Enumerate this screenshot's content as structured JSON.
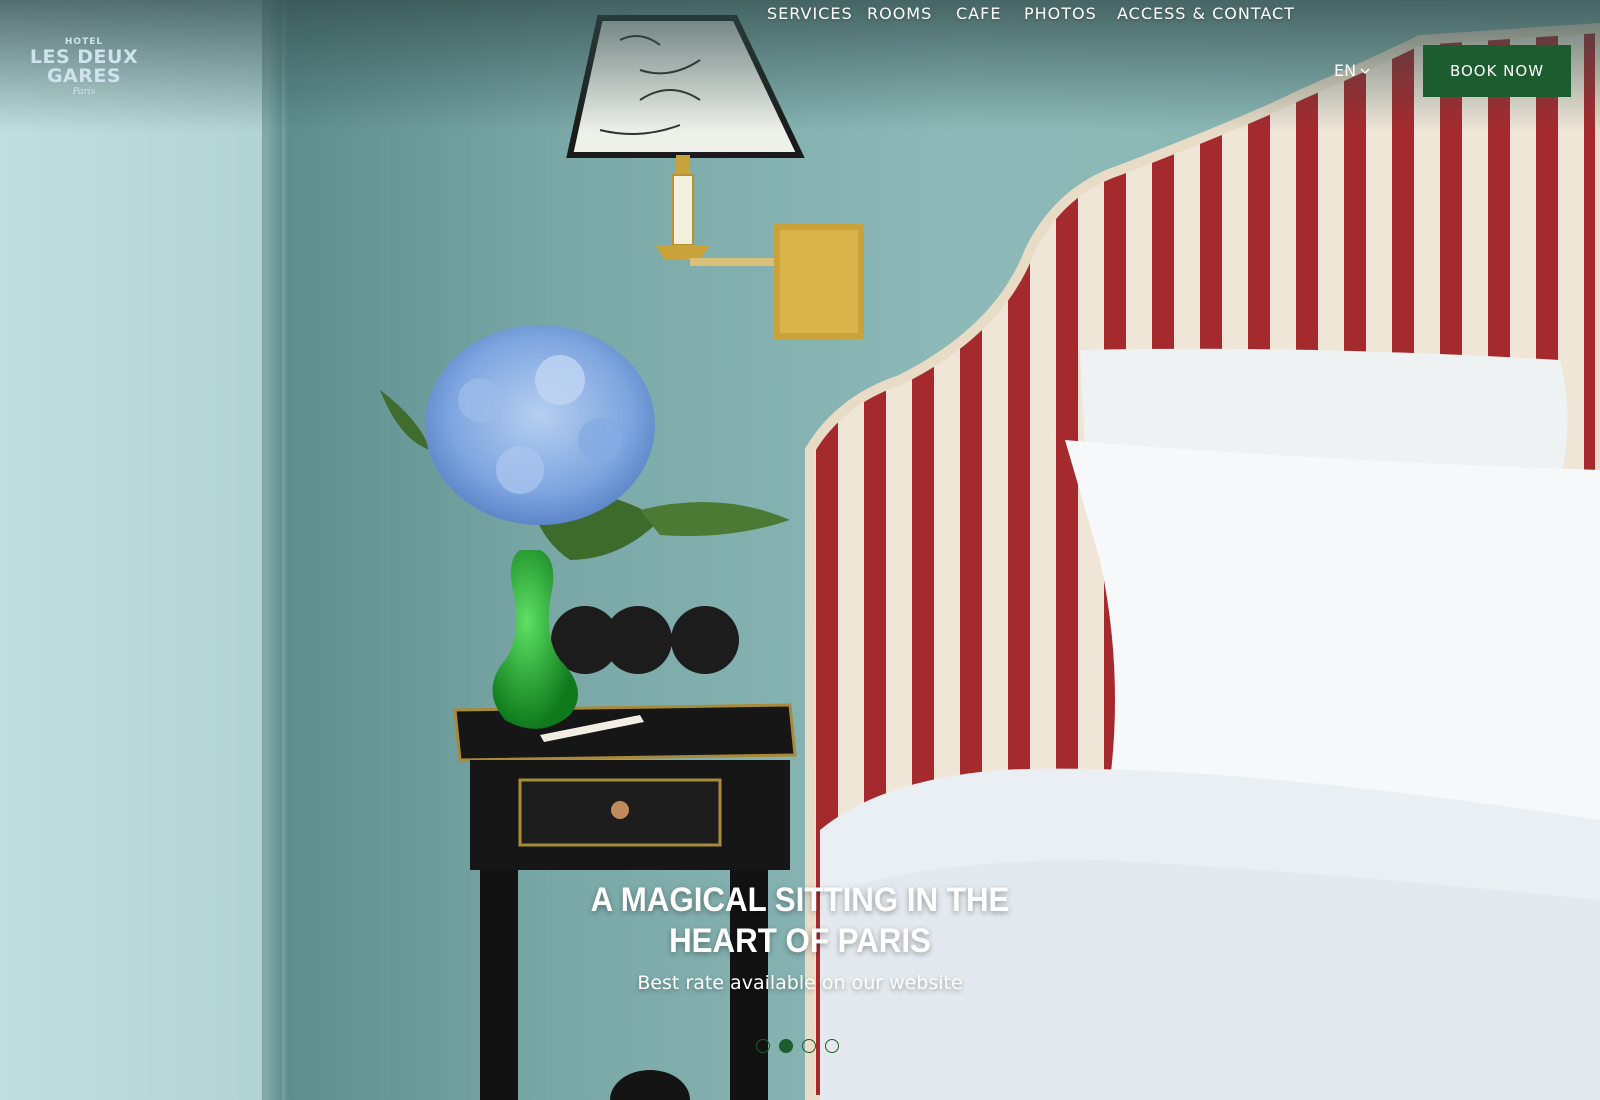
{
  "header": {
    "logo": {
      "top": "HOTEL",
      "line1": "LES DEUX",
      "line2": "GARES",
      "sub": "Paris"
    },
    "nav": [
      {
        "label": "SERVICES"
      },
      {
        "label": "ROOMS"
      },
      {
        "label": "CAFE"
      },
      {
        "label": "PHOTOS"
      },
      {
        "label": "ACCESS & CONTACT"
      }
    ],
    "language": {
      "selected": "EN",
      "icon": "chevron-down-icon"
    },
    "book_button": "BOOK NOW"
  },
  "hero": {
    "title_line1": "A MAGICAL SITTING IN THE",
    "title_line2": "HEART OF PARIS",
    "subtitle": "Best rate available on our website",
    "slides": {
      "count": 4,
      "active_index": 1
    }
  },
  "colors": {
    "accent_green": "#1c5c2e",
    "logo_blue": "#cfe3ef",
    "wall_teal": "#8fb8b5"
  }
}
